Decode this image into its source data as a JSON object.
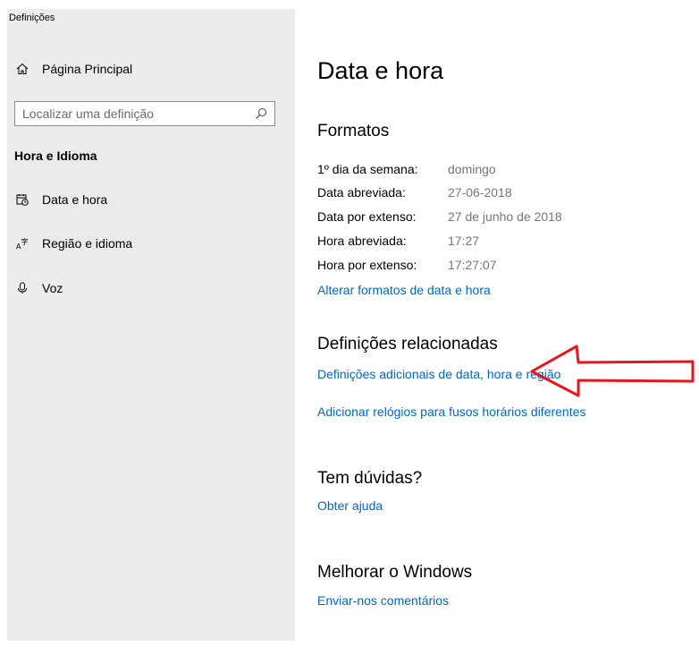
{
  "window": {
    "title": "Definições"
  },
  "sidebar": {
    "home": {
      "label": "Página Principal",
      "icon": "home-icon"
    },
    "search": {
      "placeholder": "Localizar uma definição",
      "icon": "search-icon"
    },
    "section_title": "Hora e Idioma",
    "items": [
      {
        "label": "Data e hora",
        "icon": "calendar-clock-icon"
      },
      {
        "label": "Região e idioma",
        "icon": "language-icon"
      },
      {
        "label": "Voz",
        "icon": "microphone-icon"
      }
    ]
  },
  "main": {
    "title": "Data e hora",
    "formats": {
      "heading": "Formatos",
      "rows": [
        {
          "key": "1º dia da semana:",
          "value": "domingo"
        },
        {
          "key": "Data abreviada:",
          "value": "27-06-2018"
        },
        {
          "key": "Data por extenso:",
          "value": "27 de junho de 2018"
        },
        {
          "key": "Hora abreviada:",
          "value": "17:27"
        },
        {
          "key": "Hora por extenso:",
          "value": "17:27:07"
        }
      ],
      "change_link": "Alterar formatos de data e hora"
    },
    "related": {
      "heading": "Definições relacionadas",
      "links": [
        "Definições adicionais de data, hora e região",
        "Adicionar relógios para fusos horários diferentes"
      ]
    },
    "help": {
      "heading": "Tem dúvidas?",
      "link": "Obter ajuda"
    },
    "improve": {
      "heading": "Melhorar o Windows",
      "link": "Enviar-nos comentários"
    }
  },
  "colors": {
    "sidebar_bg": "#ebebeb",
    "link": "#0067c0",
    "value_text": "#767676",
    "annotation_arrow": "#e8141c"
  }
}
